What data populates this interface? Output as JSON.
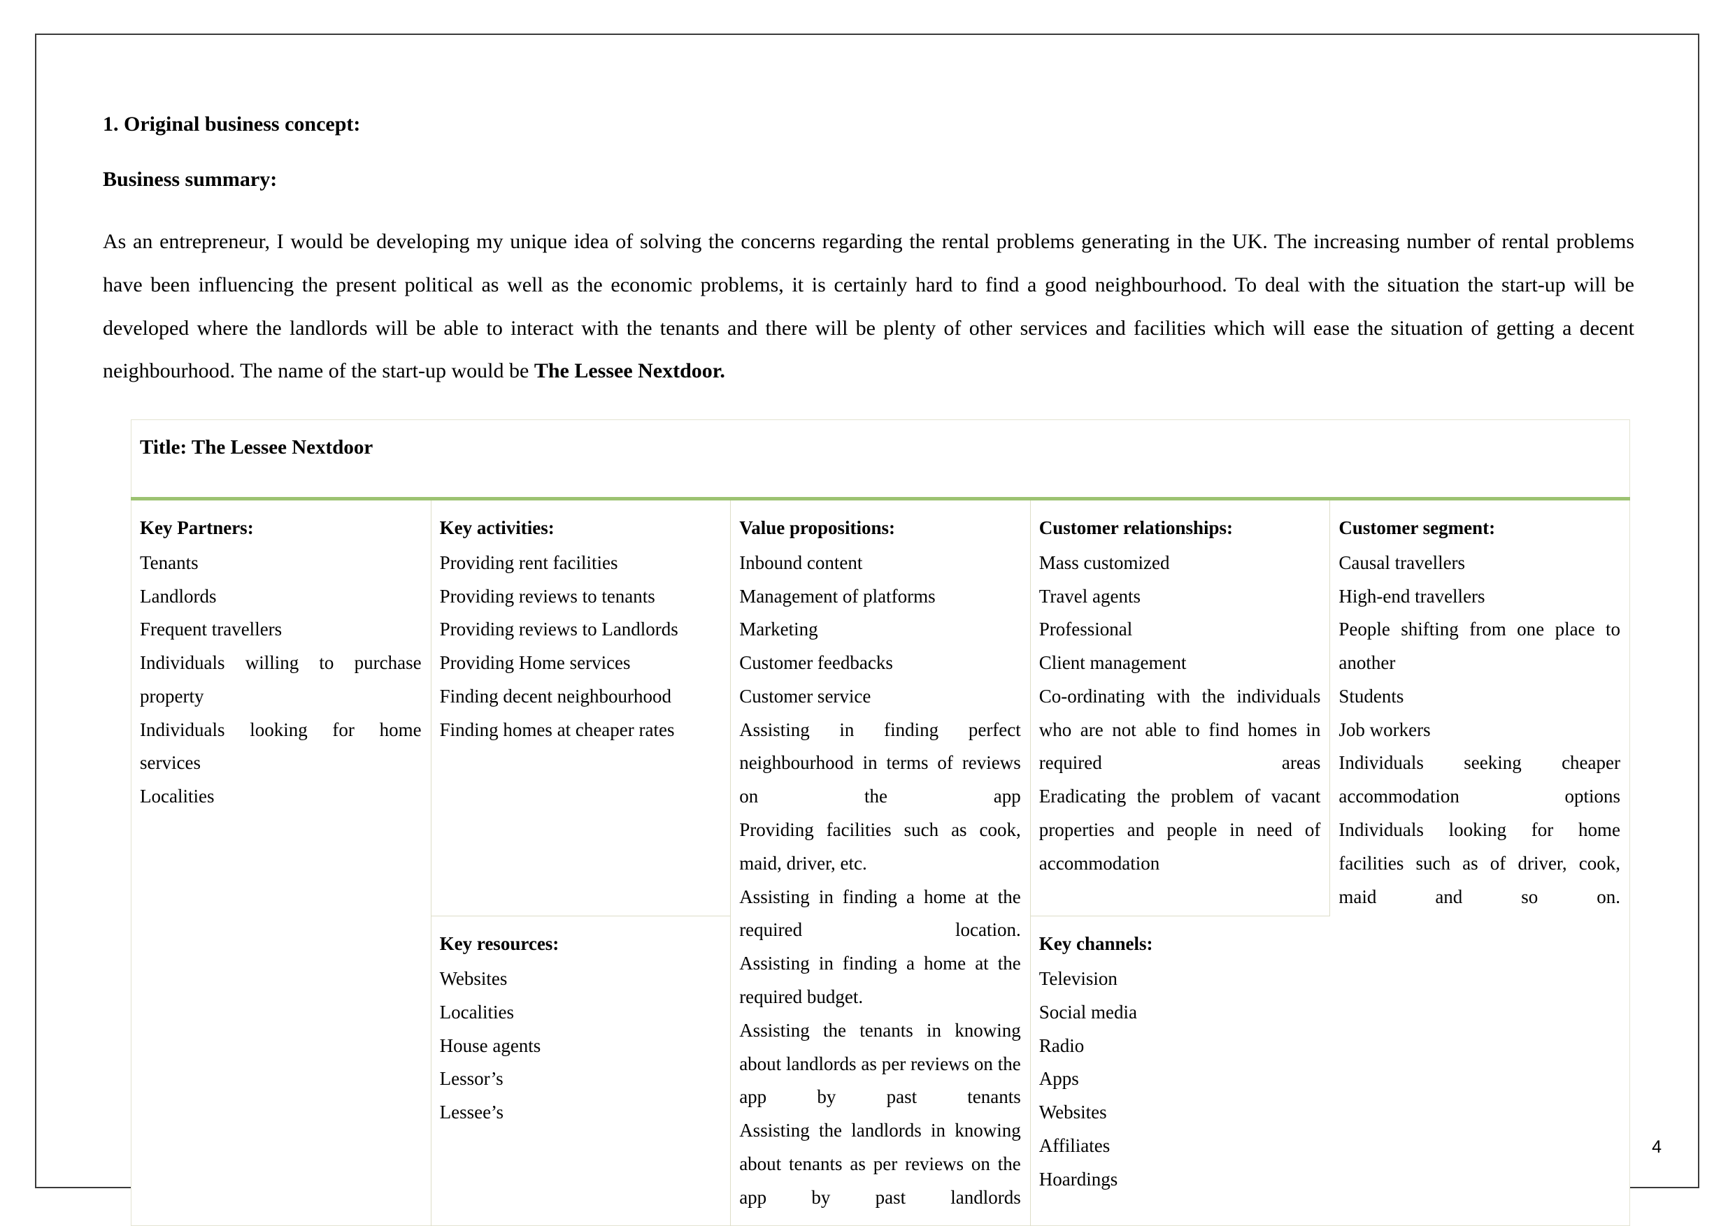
{
  "document": {
    "heading": "1. Original business concept:",
    "subheading": "Business summary:",
    "paragraph_part1": "As an entrepreneur, I would be developing my unique idea of solving the concerns regarding the rental problems generating in the UK. The increasing number of rental problems have been influencing the present political as well as the economic problems, it is certainly hard to find a good neighbourhood. To deal with the situation the start-up will be developed where the landlords will be able to interact with the tenants and there will be plenty of other services and facilities which will ease the situation of getting a decent neighbourhood. The name of the start-up would be ",
    "paragraph_bold": "The Lessee Nextdoor.",
    "page_number": "4"
  },
  "canvas": {
    "title": "Title: The Lessee Nextdoor",
    "key_partners": {
      "heading": "Key Partners:",
      "items": [
        "Tenants",
        "Landlords",
        "Frequent travellers",
        "Individuals willing to purchase property",
        "Individuals looking for home services",
        "Localities"
      ]
    },
    "key_activities": {
      "heading": "Key activities:",
      "items": [
        "Providing rent facilities",
        "Providing reviews to tenants",
        "Providing reviews to Landlords",
        "Providing Home services",
        "Finding decent neighbourhood",
        "Finding homes at cheaper rates"
      ]
    },
    "key_resources": {
      "heading": "Key resources:",
      "items": [
        "Websites",
        "Localities",
        "House agents",
        "Lessor’s",
        "Lessee’s"
      ]
    },
    "value_propositions": {
      "heading": "Value propositions:",
      "items": [
        "Inbound content",
        "Management of platforms",
        "Marketing",
        "Customer feedbacks",
        "Customer service",
        "Assisting in finding perfect neighbourhood in terms of reviews on the app",
        "Providing facilities such as cook, maid, driver, etc.",
        "Assisting in finding a home at the required location.",
        "Assisting in finding a home at the required budget.",
        "Assisting the tenants in knowing about landlords as per reviews on the app by past tenants",
        "Assisting the landlords in knowing about tenants as per reviews on the app by past landlords"
      ]
    },
    "customer_relationships": {
      "heading": "Customer relationships:",
      "items": [
        "Mass customized",
        "Travel agents",
        "Professional",
        "Client management",
        "Co-ordinating with the individuals who are not able to find homes in required areas",
        "Eradicating the problem of vacant properties and people in need of accommodation"
      ]
    },
    "key_channels": {
      "heading": "Key channels:",
      "items": [
        "Television",
        "Social media",
        "Radio",
        "Apps",
        "Websites",
        "Affiliates",
        "Hoardings"
      ]
    },
    "customer_segment": {
      "heading": "Customer segment:",
      "items": [
        "Causal travellers",
        "High-end travellers",
        "People shifting from one place to another",
        "Students",
        "Job workers",
        "Individuals seeking cheaper accommodation options",
        "Individuals looking for home facilities such as of driver, cook, maid and so on."
      ]
    }
  }
}
